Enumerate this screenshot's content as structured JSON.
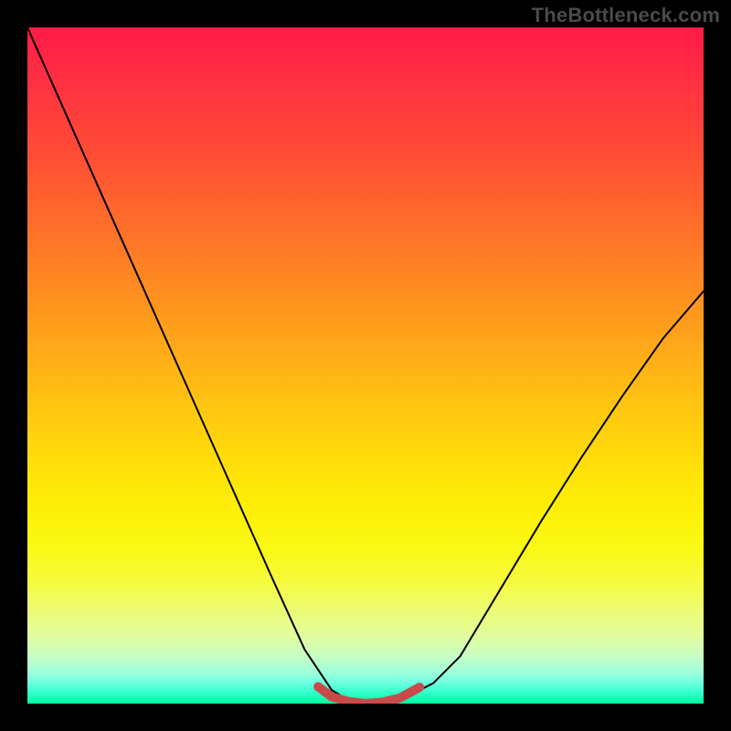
{
  "watermark": "TheBottleneck.com",
  "chart_data": {
    "type": "line",
    "title": "",
    "xlabel": "",
    "ylabel": "",
    "xlim": [
      0,
      1
    ],
    "ylim": [
      0,
      1
    ],
    "grid": false,
    "legend": false,
    "series": [
      {
        "name": "curve",
        "color": "#000000",
        "stroke_width": 2,
        "x": [
          0.0,
          0.06,
          0.12,
          0.18,
          0.24,
          0.3,
          0.36,
          0.41,
          0.45,
          0.475,
          0.5,
          0.525,
          0.56,
          0.6,
          0.64,
          0.7,
          0.76,
          0.82,
          0.88,
          0.94,
          1.0
        ],
        "y": [
          1.0,
          0.865,
          0.73,
          0.595,
          0.46,
          0.325,
          0.19,
          0.08,
          0.02,
          0.005,
          0.0,
          0.003,
          0.01,
          0.03,
          0.07,
          0.17,
          0.27,
          0.365,
          0.455,
          0.54,
          0.61
        ]
      },
      {
        "name": "bottom-highlight",
        "color": "#c94a4a",
        "stroke_width": 10,
        "x": [
          0.43,
          0.45,
          0.475,
          0.5,
          0.525,
          0.55,
          0.58
        ],
        "y": [
          0.025,
          0.01,
          0.003,
          0.0,
          0.002,
          0.008,
          0.024
        ]
      }
    ],
    "background_gradient": {
      "orientation": "vertical",
      "stops": [
        {
          "pos": 0.0,
          "color": "#ff1a46"
        },
        {
          "pos": 0.17,
          "color": "#ff4837"
        },
        {
          "pos": 0.38,
          "color": "#ff8a22"
        },
        {
          "pos": 0.57,
          "color": "#ffc810"
        },
        {
          "pos": 0.72,
          "color": "#fdf108"
        },
        {
          "pos": 0.86,
          "color": "#eefc72"
        },
        {
          "pos": 0.95,
          "color": "#9bffdc"
        },
        {
          "pos": 1.0,
          "color": "#00ff9d"
        }
      ]
    }
  }
}
